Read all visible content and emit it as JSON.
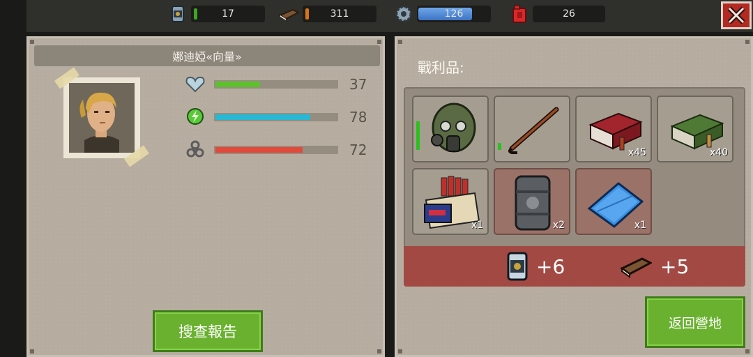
{
  "resources": {
    "food": {
      "value": "17",
      "icon": "canned-food-icon"
    },
    "wood": {
      "value": "311",
      "icon": "wood-plank-icon"
    },
    "parts": {
      "value": "126",
      "icon": "gear-icon",
      "fill": 0.75
    },
    "fuel": {
      "value": "26",
      "icon": "fuel-canister-icon"
    }
  },
  "close": {
    "label": "X"
  },
  "character": {
    "name": "娜迪婭«向量»",
    "stats": [
      {
        "icon": "heart-icon",
        "value": "37",
        "fill": 0.37,
        "color": "#5dc12a"
      },
      {
        "icon": "energy-icon",
        "value": "78",
        "fill": 0.78,
        "color": "#27b9d4"
      },
      {
        "icon": "radiation-icon",
        "value": "72",
        "fill": 0.72,
        "color": "#e2493a"
      }
    ]
  },
  "buttons": {
    "report": "搜查報告",
    "return": "返回營地"
  },
  "loot": {
    "title": "戰利品:",
    "items": [
      {
        "name": "gas-mask",
        "qty": "",
        "durability": 0.62,
        "red": false
      },
      {
        "name": "crowbar",
        "qty": "",
        "durability": 0.15,
        "red": false
      },
      {
        "name": "red-ammo-box",
        "qty": "x45",
        "red": false
      },
      {
        "name": "green-ammo-box",
        "qty": "x40",
        "red": false
      },
      {
        "name": "shotgun-shells-box",
        "qty": "x1",
        "red": false
      },
      {
        "name": "metal-barrel",
        "qty": "x2",
        "red": true
      },
      {
        "name": "blue-tarp",
        "qty": "x1",
        "red": true
      }
    ],
    "rewards": [
      {
        "icon": "canned-food-icon",
        "value": "+6"
      },
      {
        "icon": "wood-plank-icon",
        "value": "+5"
      }
    ]
  }
}
